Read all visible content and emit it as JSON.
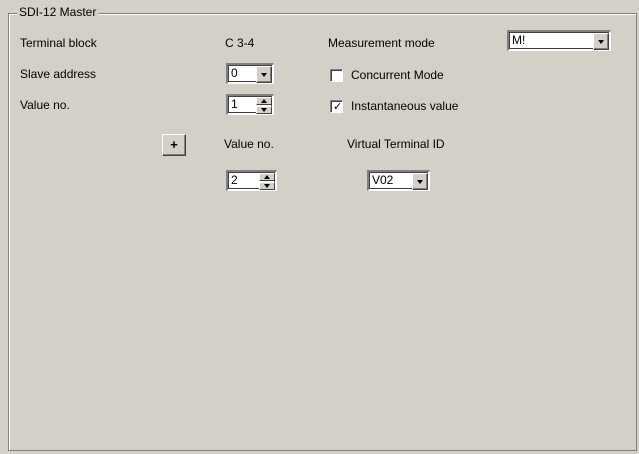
{
  "group": {
    "title": "SDI-12 Master"
  },
  "labels": {
    "terminal_block": "Terminal block",
    "terminal_block_value": "C 3-4",
    "measurement_mode": "Measurement mode",
    "slave_address": "Slave address",
    "value_no": "Value no.",
    "value_no_col": "Value no.",
    "virtual_terminal_id": "Virtual Terminal ID"
  },
  "fields": {
    "measurement_mode": "M!",
    "slave_address": "0",
    "value_no": "1",
    "value_no_2": "2",
    "virtual_terminal_id": "V02"
  },
  "checkboxes": {
    "concurrent_mode": {
      "label": "Concurrent Mode",
      "checked": false
    },
    "instantaneous_value": {
      "label": "Instantaneous value",
      "checked": true
    }
  },
  "buttons": {
    "add": "+"
  },
  "icons": {
    "check": "✓"
  }
}
